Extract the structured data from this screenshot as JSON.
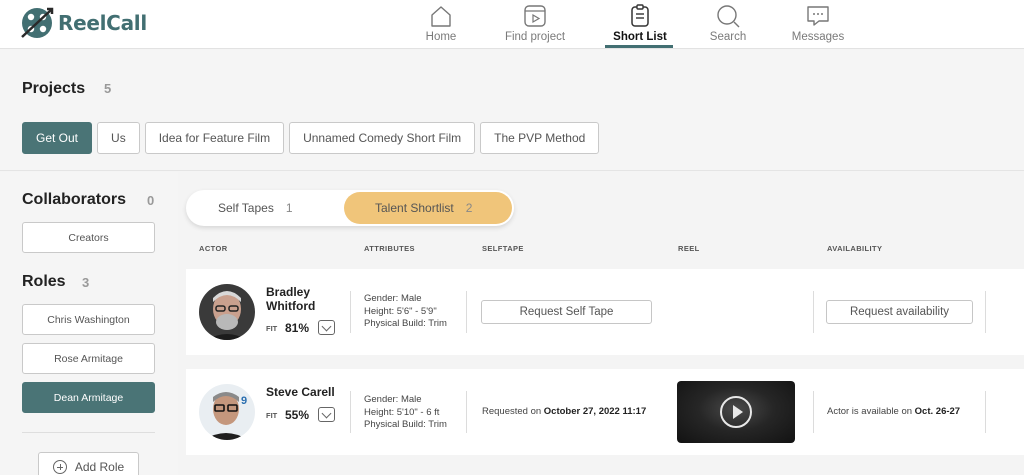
{
  "app": {
    "name": "ReelCall"
  },
  "colors": {
    "accent": "#4a7476",
    "highlight": "#f0c57a"
  },
  "nav": [
    {
      "label": "Home",
      "icon": "home-icon",
      "active": false
    },
    {
      "label": "Find project",
      "icon": "play-square-icon",
      "active": false
    },
    {
      "label": "Short List",
      "icon": "clipboard-icon",
      "active": true
    },
    {
      "label": "Search",
      "icon": "search-icon",
      "active": false
    },
    {
      "label": "Messages",
      "icon": "message-icon",
      "active": false
    }
  ],
  "projects": {
    "title": "Projects",
    "count": "5",
    "items": [
      {
        "label": "Get Out",
        "active": true
      },
      {
        "label": "Us",
        "active": false
      },
      {
        "label": "Idea for Feature Film",
        "active": false
      },
      {
        "label": "Unnamed Comedy Short Film",
        "active": false
      },
      {
        "label": "The PVP Method",
        "active": false
      }
    ]
  },
  "sidebar": {
    "collaborators": {
      "title": "Collaborators",
      "count": "0",
      "button": "Creators"
    },
    "roles": {
      "title": "Roles",
      "count": "3",
      "items": [
        {
          "label": "Chris Washington",
          "active": false
        },
        {
          "label": "Rose Armitage",
          "active": false
        },
        {
          "label": "Dean Armitage",
          "active": true
        }
      ]
    },
    "add_role": "Add Role"
  },
  "tabs": [
    {
      "label": "Self Tapes",
      "count": "1",
      "active": false
    },
    {
      "label": "Talent Shortlist",
      "count": "2",
      "active": true
    }
  ],
  "table": {
    "headers": [
      "ACTOR",
      "ATTRIBUTES",
      "SELFTAPE",
      "REEL",
      "AVAILABILITY"
    ],
    "rows": [
      {
        "name_line1": "Bradley",
        "name_line2": "Whitford",
        "fit_label": "FIT",
        "fit": "81%",
        "attributes": [
          "Gender: Male",
          "Height: 5'6\" - 5'9\"",
          "Physical Build: Trim"
        ],
        "selftape_button": "Request Self Tape",
        "availability_button": "Request availability"
      },
      {
        "name_line1": "Steve Carell",
        "fit_label": "FIT",
        "fit": "55%",
        "attributes": [
          "Gender: Male",
          "Height: 5'10\" - 6 ft",
          "Physical Build: Trim"
        ],
        "selftape_prefix": "Requested on ",
        "selftape_date": "October 27, 2022 11:17",
        "availability_prefix": "Actor is available on ",
        "availability_date": "Oct. 26-27"
      }
    ]
  }
}
